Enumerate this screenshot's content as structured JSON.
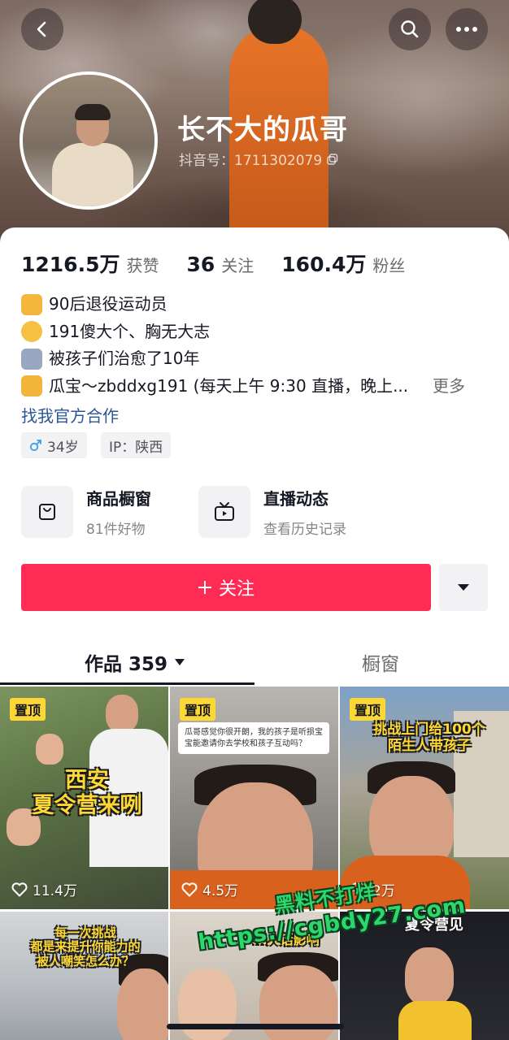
{
  "profile": {
    "name": "长不大的瓜哥",
    "douyin_id": "抖音号：1711302079"
  },
  "stats": [
    {
      "value": "1216.5万",
      "label": "获赞"
    },
    {
      "value": "36",
      "label": "关注"
    },
    {
      "value": "160.4万",
      "label": "粉丝"
    }
  ],
  "bio": {
    "lines": [
      "90后退役运动员",
      "191傻大个、胸无大志",
      "被孩子们治愈了10年",
      "瓜宝～zbddxg191 (每天上午 9:30 直播，晚上..."
    ],
    "more": "更多",
    "link": "找我官方合作"
  },
  "tags": {
    "age": "34岁",
    "ip": "IP：陕西"
  },
  "entries": [
    {
      "title": "商品橱窗",
      "subtitle": "81件好物",
      "icon": "bag-icon"
    },
    {
      "title": "直播动态",
      "subtitle": "查看历史记录",
      "icon": "tv-icon"
    }
  ],
  "actions": {
    "follow": "关注"
  },
  "tabs": {
    "works": "作品 359",
    "shop": "橱窗"
  },
  "videos": [
    {
      "pin": "置顶",
      "caption": "西安\n夏令营来咧",
      "likes": "11.4万"
    },
    {
      "pin": "置顶",
      "note": "瓜哥感觉你很开朗，我的孩子是听损宝宝能邀请你去学校和孩子互动吗？",
      "likes": "4.5万"
    },
    {
      "pin": "置顶",
      "caption": "挑战上门给100个\n陌生人带孩子",
      "likes": "2万"
    },
    {
      "caption": "每一次挑战\n都是来提升你能力的\n被人嘲笑怎么办？"
    },
    {
      "caption": "...人话影响"
    },
    {
      "caption": "夏令营见"
    }
  ],
  "watermark": {
    "line1": "黑料不打烊",
    "line2": "https://cgbdy27.com"
  },
  "colors": {
    "accent": "#fe2c55",
    "link": "#2c5596",
    "pin": "#fdd835"
  }
}
